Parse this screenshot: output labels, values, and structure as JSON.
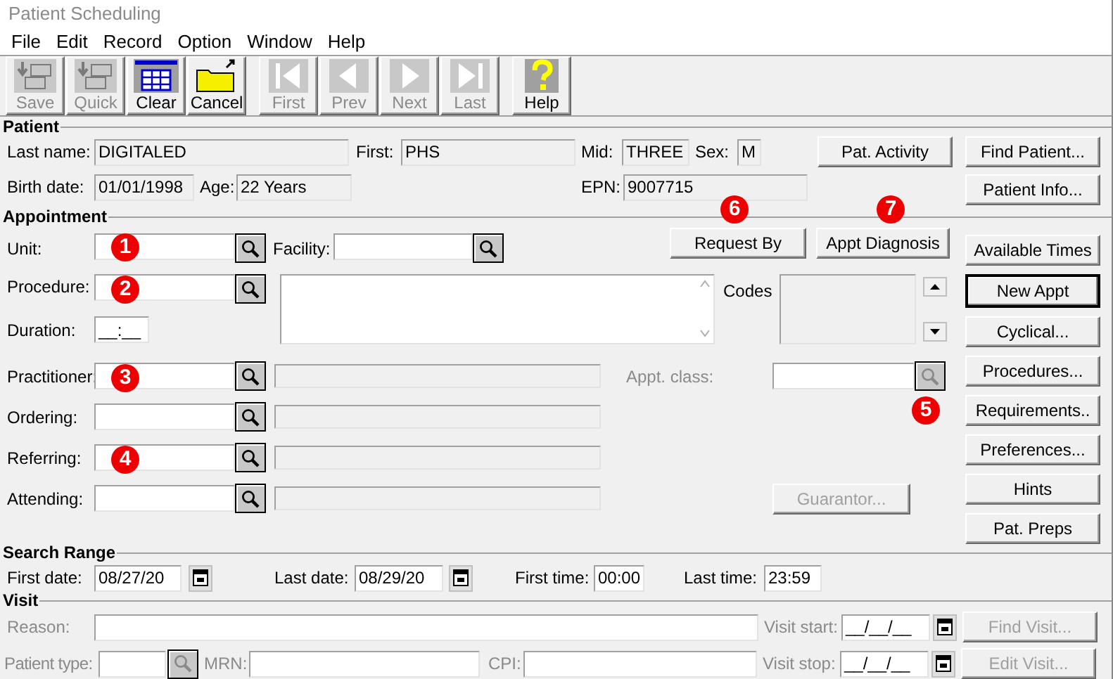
{
  "window": {
    "title": "Patient Scheduling"
  },
  "menu": [
    "File",
    "Edit",
    "Record",
    "Option",
    "Window",
    "Help"
  ],
  "toolbar": [
    {
      "label": "Save",
      "disabled": true
    },
    {
      "label": "Quick",
      "disabled": true
    },
    {
      "label": "Clear",
      "disabled": false
    },
    {
      "label": "Cancel",
      "disabled": false
    },
    {
      "label": "First",
      "disabled": true
    },
    {
      "label": "Prev",
      "disabled": true
    },
    {
      "label": "Next",
      "disabled": true
    },
    {
      "label": "Last",
      "disabled": true
    },
    {
      "label": "Help",
      "disabled": false
    }
  ],
  "patient": {
    "title": "Patient",
    "last_name": {
      "label": "Last name:",
      "value": "DIGITALED"
    },
    "first": {
      "label": "First:",
      "value": "PHS"
    },
    "mid": {
      "label": "Mid:",
      "value": "THREE"
    },
    "sex": {
      "label": "Sex:",
      "value": "M"
    },
    "birth_date": {
      "label": "Birth date:",
      "value": "01/01/1998"
    },
    "age": {
      "label": "Age:",
      "value": "22 Years"
    },
    "epn": {
      "label": "EPN:",
      "value": "9007715"
    },
    "pat_activity": {
      "label": "Pat. Activity"
    },
    "side_buttons": [
      {
        "label": "Find Patient..."
      },
      {
        "label": "Patient Info..."
      }
    ]
  },
  "appointment": {
    "title": "Appointment",
    "unit": {
      "label": "Unit:",
      "badge": "1"
    },
    "facility": {
      "label": "Facility:"
    },
    "request_by": {
      "label": "Request By",
      "badge": "6"
    },
    "appt_diagnosis": {
      "label": "Appt Diagnosis",
      "badge": "7"
    },
    "procedure": {
      "label": "Procedure:",
      "badge": "2"
    },
    "duration": {
      "label": "Duration:",
      "value": "__:__"
    },
    "codes": {
      "label": "Codes"
    },
    "providers": [
      {
        "label": "Practitioner:",
        "badge": "3"
      },
      {
        "label": "Ordering:"
      },
      {
        "label": "Referring:",
        "badge": "4"
      },
      {
        "label": "Attending:"
      }
    ],
    "appt_class": {
      "label": "Appt. class:",
      "disabled": true,
      "badge": "5"
    },
    "guarantor": {
      "label": "Guarantor...",
      "disabled": true
    },
    "side_buttons": [
      {
        "label": "Available Times",
        "default": false
      },
      {
        "label": "New Appt",
        "default": true
      },
      {
        "label": "Cyclical...",
        "default": false
      },
      {
        "label": "Procedures...",
        "default": false
      },
      {
        "label": "Requirements..",
        "default": false
      },
      {
        "label": "Preferences...",
        "default": false
      },
      {
        "label": "Hints",
        "default": false
      },
      {
        "label": "Pat. Preps",
        "default": false
      }
    ]
  },
  "search_range": {
    "title": "Search Range",
    "first_date": {
      "label": "First date:",
      "value": "08/27/20"
    },
    "last_date": {
      "label": "Last date:",
      "value": "08/29/20"
    },
    "first_time": {
      "label": "First time:",
      "value": "00:00"
    },
    "last_time": {
      "label": "Last time:",
      "value": "23:59"
    }
  },
  "visit": {
    "title": "Visit",
    "disabled": true,
    "reason": {
      "label": "Reason:"
    },
    "patient_type": {
      "label": "Patient type:"
    },
    "mrn": {
      "label": "MRN:"
    },
    "cpi": {
      "label": "CPI:"
    },
    "visit_start": {
      "label": "Visit start:",
      "value": "__/__/__"
    },
    "visit_stop": {
      "label": "Visit stop:",
      "value": "__/__/__"
    },
    "find_visit": {
      "label": "Find Visit...",
      "disabled": true
    },
    "edit_visit": {
      "label": "Edit Visit...",
      "disabled": true
    }
  }
}
